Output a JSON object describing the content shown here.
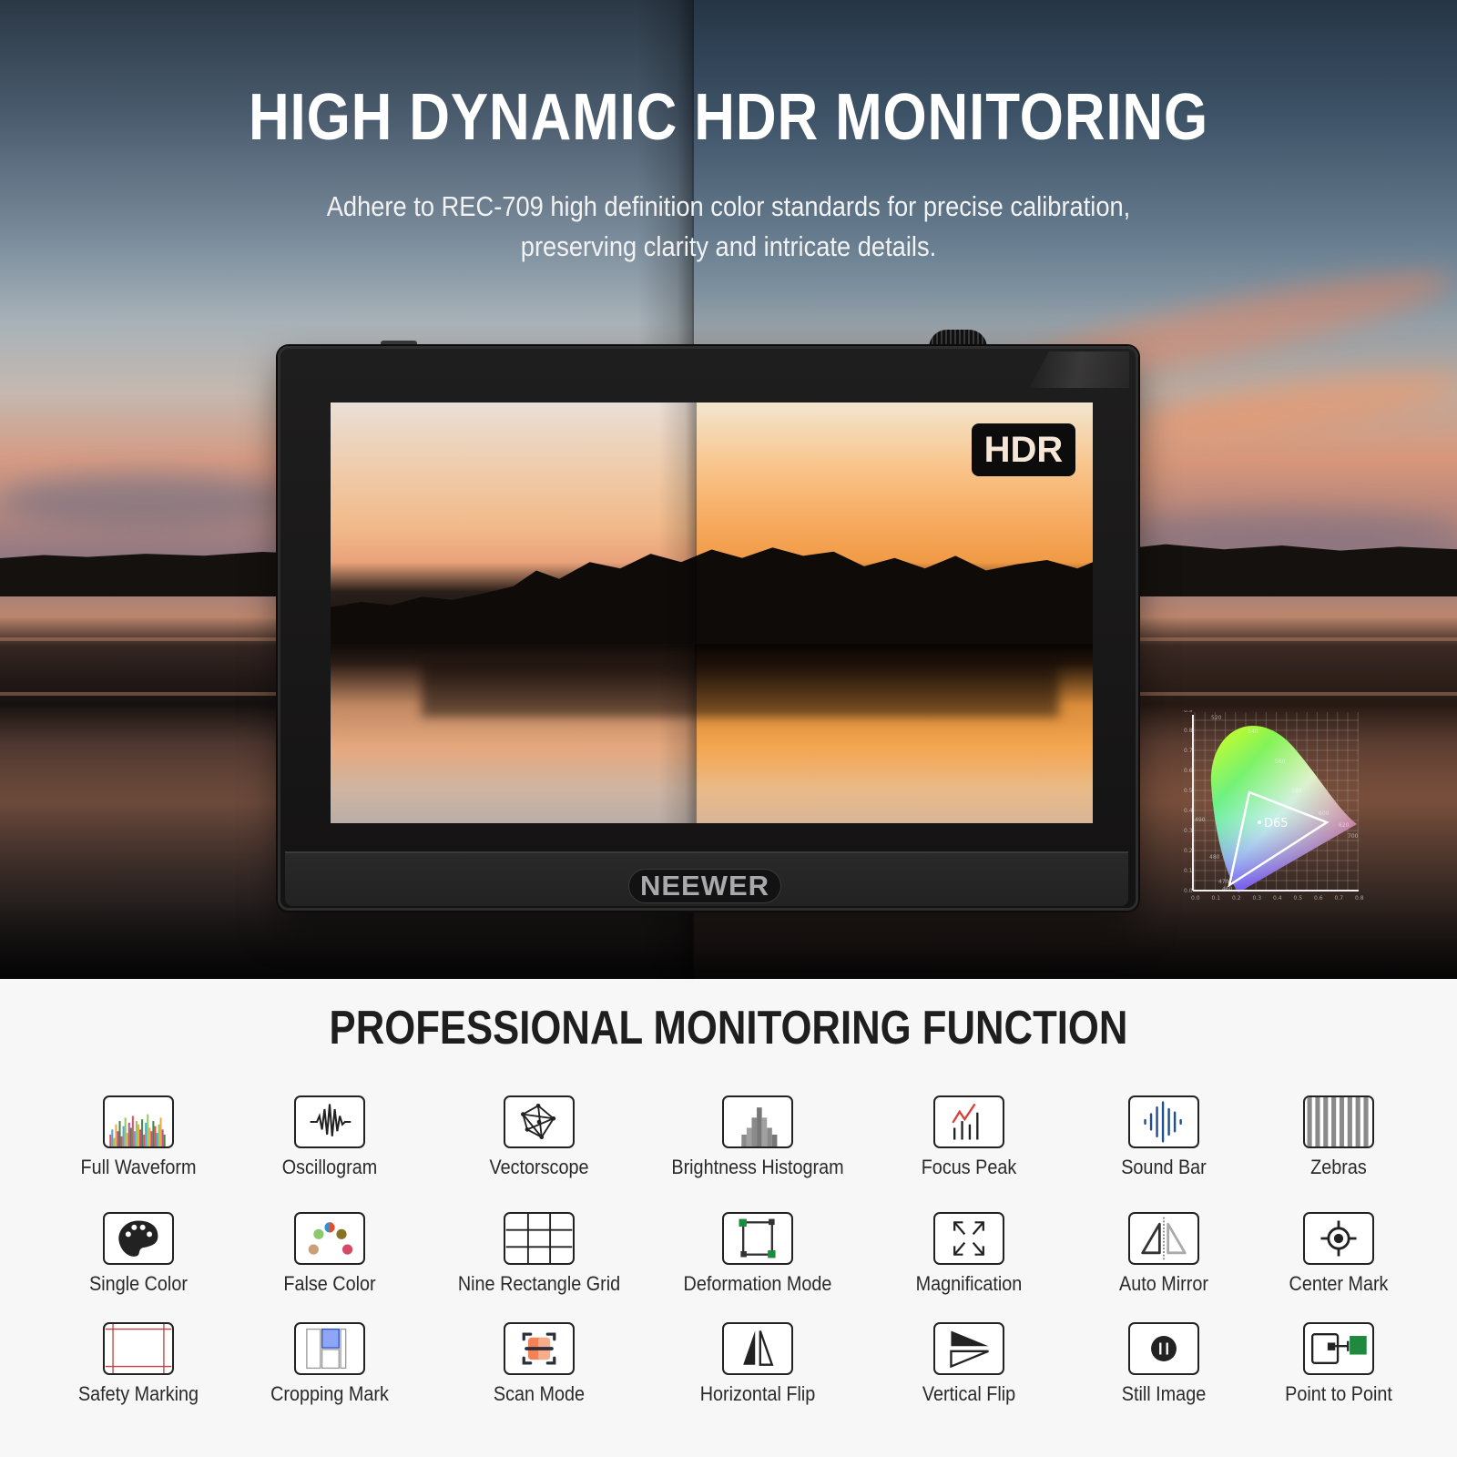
{
  "hero": {
    "title": "HIGH DYNAMIC HDR MONITORING",
    "subtitle_line1": "Adhere to REC-709 high definition color standards for precise calibration,",
    "subtitle_line2": "preserving clarity and intricate details."
  },
  "monitor": {
    "badge": "HDR",
    "brand": "NEEWER"
  },
  "cie_diagram": {
    "whitepoint_label": "D65",
    "y_ticks": [
      "0.0",
      "0.1",
      "0.2",
      "0.3",
      "0.4",
      "0.5",
      "0.6",
      "0.7",
      "0.8",
      "0.9"
    ],
    "x_ticks": [
      "0.0",
      "0.1",
      "0.2",
      "0.3",
      "0.4",
      "0.5",
      "0.6",
      "0.7",
      "0.8"
    ],
    "wavelength_labels": [
      "460",
      "470",
      "480",
      "490",
      "520",
      "540",
      "560",
      "580",
      "600",
      "620",
      "700"
    ]
  },
  "functions": {
    "title": "PROFESSIONAL MONITORING FUNCTION",
    "items": [
      {
        "label": "Full Waveform",
        "icon": "full-waveform"
      },
      {
        "label": "Oscillogram",
        "icon": "oscillogram"
      },
      {
        "label": "Vectorscope",
        "icon": "vectorscope"
      },
      {
        "label": "Brightness Histogram",
        "icon": "brightness-histogram"
      },
      {
        "label": "Focus Peak",
        "icon": "focus-peak"
      },
      {
        "label": "Sound Bar",
        "icon": "sound-bar"
      },
      {
        "label": "Zebras",
        "icon": "zebras"
      },
      {
        "label": "Single Color",
        "icon": "single-color"
      },
      {
        "label": "False Color",
        "icon": "false-color"
      },
      {
        "label": "Nine Rectangle Grid",
        "icon": "nine-grid"
      },
      {
        "label": "Deformation Mode",
        "icon": "deformation-mode"
      },
      {
        "label": "Magnification",
        "icon": "magnification"
      },
      {
        "label": "Auto Mirror",
        "icon": "auto-mirror"
      },
      {
        "label": "Center Mark",
        "icon": "center-mark"
      },
      {
        "label": "Safety Marking",
        "icon": "safety-marking"
      },
      {
        "label": "Cropping Mark",
        "icon": "cropping-mark"
      },
      {
        "label": "Scan Mode",
        "icon": "scan-mode"
      },
      {
        "label": "Horizontal Flip",
        "icon": "horizontal-flip"
      },
      {
        "label": "Vertical Flip",
        "icon": "vertical-flip"
      },
      {
        "label": "Still Image",
        "icon": "still-image"
      },
      {
        "label": "Point to Point",
        "icon": "point-to-point"
      }
    ]
  }
}
